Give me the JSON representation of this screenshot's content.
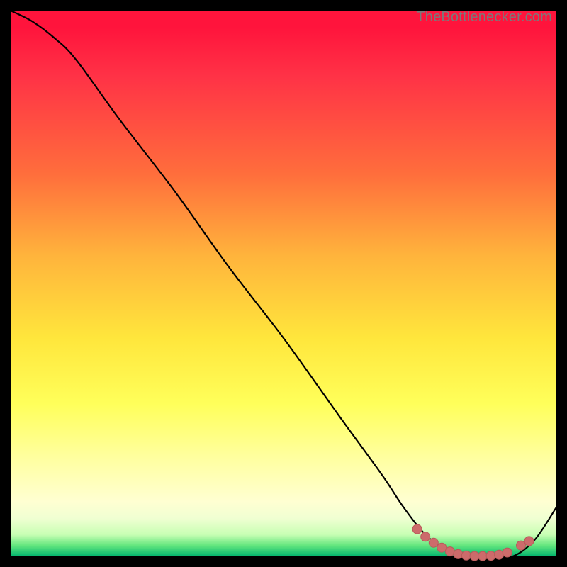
{
  "attribution": "TheBottlenecker.com",
  "colors": {
    "curve": "#000000",
    "marker_fill": "#cc6b6b",
    "marker_stroke": "#b85a5a"
  },
  "chart_data": {
    "type": "line",
    "title": "",
    "xlabel": "",
    "ylabel": "",
    "xlim": [
      0,
      100
    ],
    "ylim": [
      0,
      100
    ],
    "series": [
      {
        "name": "curve",
        "x": [
          0,
          4,
          8,
          12,
          20,
          30,
          40,
          50,
          60,
          68,
          72,
          76,
          80,
          84,
          88,
          92,
          96,
          100
        ],
        "y": [
          100,
          98,
          95,
          91,
          80,
          67,
          53,
          40,
          26,
          15,
          9,
          4,
          1,
          0,
          0,
          0,
          3,
          9
        ]
      }
    ],
    "markers": {
      "name": "optimum-band",
      "x": [
        74.5,
        76.0,
        77.5,
        79.0,
        80.5,
        82.0,
        83.5,
        85.0,
        86.5,
        88.0,
        89.5,
        91.0,
        93.5,
        95.0
      ],
      "y": [
        5.0,
        3.6,
        2.5,
        1.6,
        0.9,
        0.4,
        0.15,
        0.05,
        0.05,
        0.1,
        0.3,
        0.7,
        2.0,
        2.8
      ]
    }
  }
}
